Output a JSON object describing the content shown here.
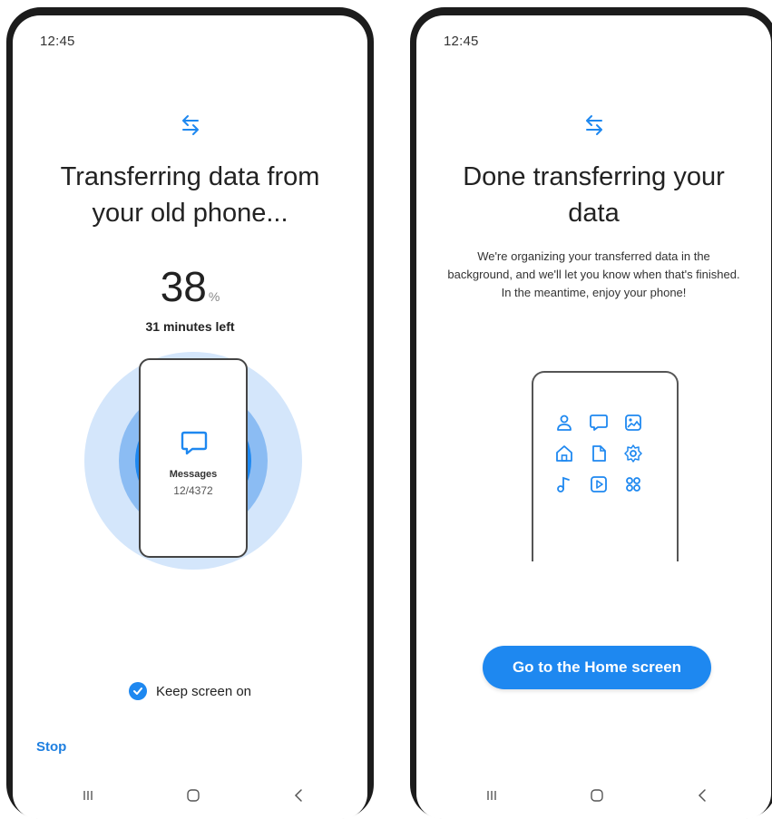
{
  "left_screen": {
    "status_time": "12:45",
    "title_line1": "Transferring data from",
    "title_line2": "your old phone...",
    "percent": "38",
    "percent_sign": "%",
    "time_left": "31 minutes left",
    "current_category": "Messages",
    "category_progress": "12/4372",
    "keep_screen_on_label": "Keep screen on",
    "keep_screen_on_checked": true,
    "stop_label": "Stop"
  },
  "right_screen": {
    "status_time": "12:45",
    "title_line1": "Done transferring your",
    "title_line2": "data",
    "description": "We're organizing your transferred data in the background, and we'll let you know when that's finished. In the meantime, enjoy your phone!",
    "home_button_label": "Go to the Home screen",
    "app_icons": [
      "contact-icon",
      "message-icon",
      "gallery-icon",
      "home-icon",
      "document-icon",
      "settings-icon",
      "music-icon",
      "video-icon",
      "apps-icon"
    ]
  },
  "navbar": {
    "buttons": [
      "recent-apps-icon",
      "home-icon",
      "back-icon"
    ]
  },
  "colors": {
    "accent": "#1e88f0",
    "ring_light": "#d4e6fb",
    "ring_mid": "#8bbcf3",
    "frame": "#1c1c1c"
  }
}
